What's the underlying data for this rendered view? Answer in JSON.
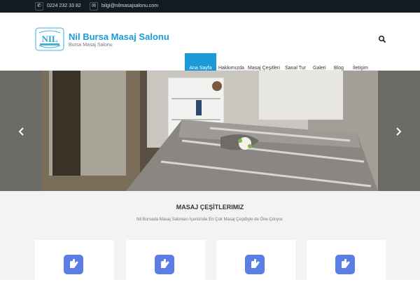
{
  "topbar": {
    "phone_icon": "phone-icon",
    "phone": "0224 232 33 82",
    "email_icon": "envelope-icon",
    "email": "bilgi@nilmasajsalonu.com"
  },
  "header": {
    "logo_name": "nil-masaj-salonu-logo",
    "title": "Nil Bursa Masaj Salonu",
    "tagline": "Bursa Masaj Salonu",
    "search_icon": "search-icon"
  },
  "nav": {
    "items": [
      {
        "label": "Ana Sayfa",
        "active": true
      },
      {
        "label": "Hakkımızda"
      },
      {
        "label": "Masaj Çeşitleri"
      },
      {
        "label": "Sanal Tur"
      },
      {
        "label": "Galeri"
      },
      {
        "label": "Blog"
      },
      {
        "label": "İletişim"
      }
    ]
  },
  "slider": {
    "prev_icon": "chevron-left-icon",
    "next_icon": "chevron-right-icon"
  },
  "services": {
    "title": "MASAJ ÇEŞİTLERIMIZ",
    "subtitle": "Nil Bursada Masaj Salonları İçerisinde En Çok Masaj Çeşidiyle de Öne Çıkıyor.",
    "cards": [
      {
        "icon": "massage-hands-icon"
      },
      {
        "icon": "massage-hands-icon"
      },
      {
        "icon": "massage-hands-icon"
      },
      {
        "icon": "massage-hands-icon"
      }
    ]
  },
  "colors": {
    "accent": "#1a9ad6",
    "topbar": "#121a22",
    "icon_bg": "#5b7ee5",
    "section_bg": "#f1f3f5"
  }
}
